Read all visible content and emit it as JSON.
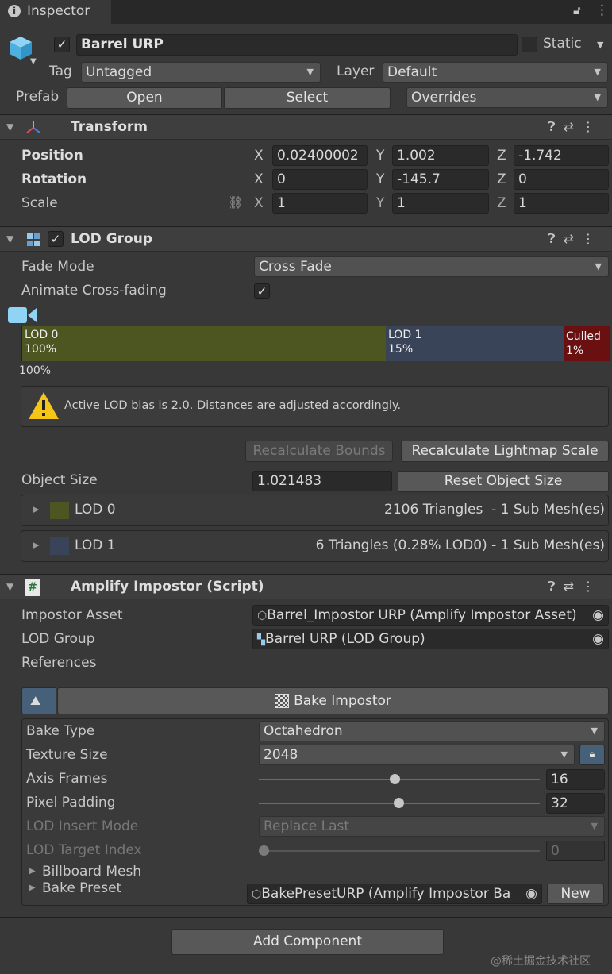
{
  "tab": {
    "title": "Inspector"
  },
  "object": {
    "name": "Barrel URP",
    "static_label": "Static",
    "tag_label": "Tag",
    "tag_value": "Untagged",
    "layer_label": "Layer",
    "layer_value": "Default",
    "prefab_label": "Prefab",
    "open_label": "Open",
    "select_label": "Select",
    "overrides_label": "Overrides"
  },
  "transform": {
    "title": "Transform",
    "position_label": "Position",
    "rotation_label": "Rotation",
    "scale_label": "Scale",
    "axis_x": "X",
    "axis_y": "Y",
    "axis_z": "Z",
    "position": [
      "0.02400002",
      "1.002",
      "-1.742"
    ],
    "rotation": [
      "0",
      "-145.7",
      "0"
    ],
    "scale": [
      "1",
      "1",
      "1"
    ]
  },
  "lod_group": {
    "title": "LOD Group",
    "fade_mode_label": "Fade Mode",
    "fade_mode_value": "Cross Fade",
    "animate_label": "Animate Cross-fading",
    "bars": [
      {
        "name": "LOD 0",
        "pct": "100%",
        "color": "#4d5521"
      },
      {
        "name": "LOD 1",
        "pct": "15%",
        "color": "#3a4458"
      },
      {
        "name": "Culled",
        "pct": "1%",
        "color": "#6a1010"
      }
    ],
    "bar_bottom_pct": "100%",
    "warning": "Active LOD bias is 2.0. Distances are adjusted accordingly.",
    "recalc_bounds": "Recalculate Bounds",
    "recalc_lightmap": "Recalculate Lightmap Scale",
    "object_size_label": "Object Size",
    "object_size_value": "1.021483",
    "reset_size": "Reset Object Size",
    "lods": [
      {
        "name": "LOD 0",
        "info": "2106 Triangles  - 1 Sub Mesh(es)",
        "color": "#4d5521"
      },
      {
        "name": "LOD 1",
        "info": "6 Triangles (0.28% LOD0) - 1 Sub Mesh(es)",
        "color": "#3a4458"
      }
    ]
  },
  "impostor": {
    "title": "Amplify Impostor (Script)",
    "asset_label": "Impostor Asset",
    "asset_value": "Barrel_Impostor URP (Amplify Impostor Asset)",
    "lodgroup_label": "LOD Group",
    "lodgroup_value": "Barrel URP (LOD Group)",
    "references_label": "References",
    "bake_button": "Bake Impostor",
    "bake_type_label": "Bake Type",
    "bake_type_value": "Octahedron",
    "texture_size_label": "Texture Size",
    "texture_size_value": "2048",
    "axis_frames_label": "Axis Frames",
    "axis_frames_value": "16",
    "pixel_padding_label": "Pixel Padding",
    "pixel_padding_value": "32",
    "lod_insert_label": "LOD Insert Mode",
    "lod_insert_value": "Replace Last",
    "lod_target_label": "LOD Target Index",
    "lod_target_value": "0",
    "billboard_label": "Billboard Mesh",
    "preset_label": "Bake Preset",
    "preset_value": "BakePresetURP (Amplify Impostor Ba",
    "new_label": "New"
  },
  "add_component": "Add Component",
  "watermark": "@稀土掘金技术社区"
}
